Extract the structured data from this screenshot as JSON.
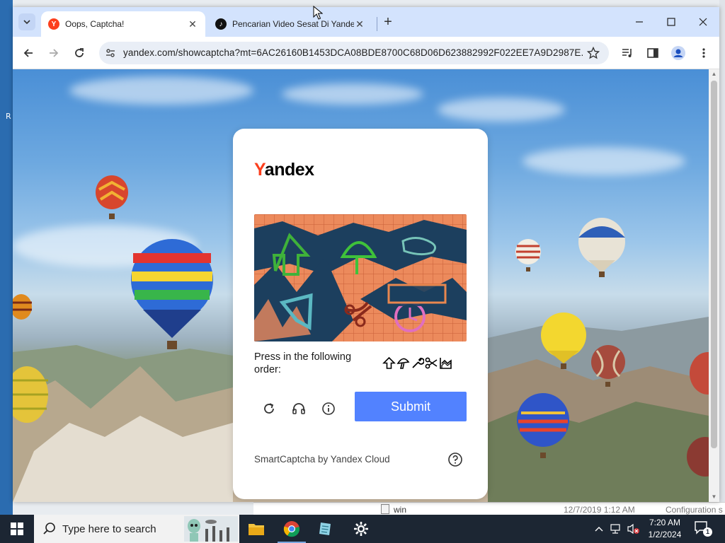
{
  "desktop": {
    "left_edge_char": "R",
    "file_name": "win",
    "file_date": "12/7/2019 1:12 AM",
    "file_type": "Configuration s"
  },
  "browser": {
    "tabs": [
      {
        "title": "Oops, Captcha!",
        "favicon": "yandex-icon",
        "active": true
      },
      {
        "title": "Pencarian Video Sesat Di Yande",
        "favicon": "tiktok-icon",
        "active": false
      }
    ],
    "url": "yandex.com/showcaptcha?mt=6AC26160B1453DCA08BDE8700C68D06D623882992F022EE7A9D2987E..."
  },
  "captcha": {
    "logo_first": "Y",
    "logo_rest": "andex",
    "instruction": "Press in the following order:",
    "order_icons": [
      "arrow-up-icon",
      "mushroom-icon",
      "wrench-icon",
      "scissors-icon",
      "chart-icon"
    ],
    "submit_label": "Submit",
    "footer": "SmartCaptcha by Yandex Cloud",
    "submit_color": "#5282ff",
    "brand_color": "#fc3f1d"
  },
  "taskbar": {
    "search_placeholder": "Type here to search",
    "time": "7:20 AM",
    "date": "1/2/2024",
    "notification_count": "1"
  }
}
